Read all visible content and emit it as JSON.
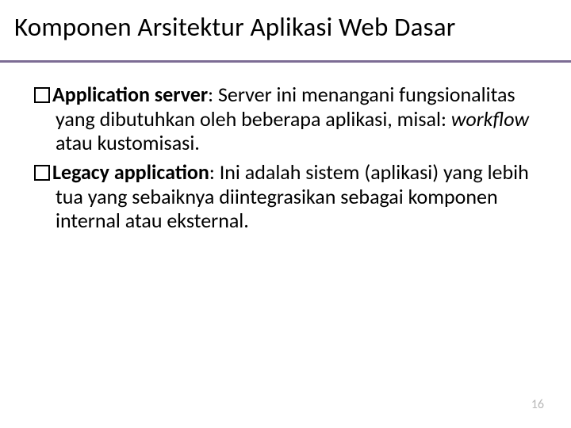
{
  "title": "Komponen Arsitektur Aplikasi Web Dasar",
  "items": [
    {
      "label": "Application server",
      "sep": ": ",
      "text1": "Server ini menangani fungsionalitas yang dibutuhkan oleh beberapa aplikasi, misal: ",
      "italic": "workflow",
      "text2": " atau kustomisasi."
    },
    {
      "label": "Legacy application",
      "sep": ": ",
      "text1": "Ini adalah sistem (aplikasi) yang lebih tua yang sebaiknya diintegrasikan sebagai komponen internal atau eksternal.",
      "italic": "",
      "text2": ""
    }
  ],
  "page_number": "16"
}
